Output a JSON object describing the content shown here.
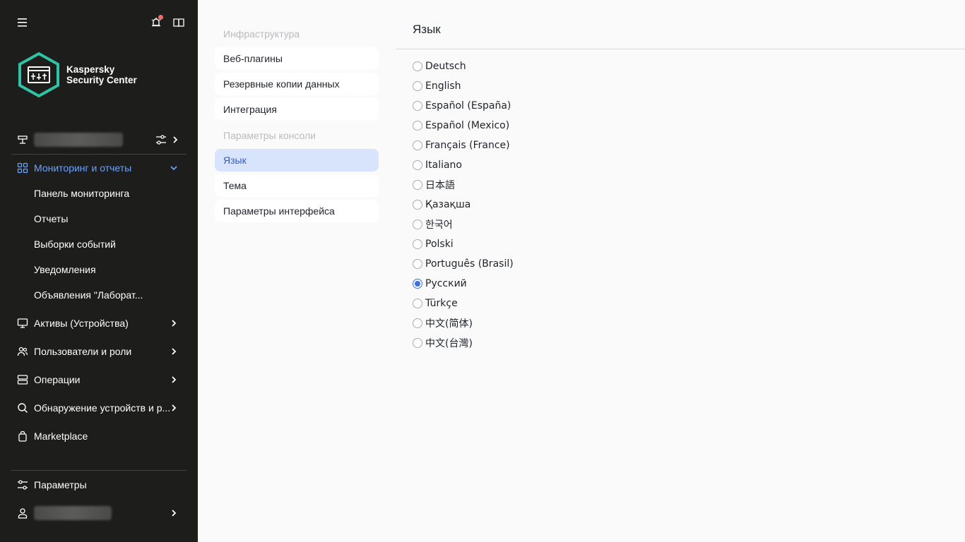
{
  "app": {
    "brand_line1": "Kaspersky",
    "brand_line2": "Security Center"
  },
  "colors": {
    "sidebar_bg": "#1d1d1b",
    "accent": "#3d6fe0",
    "active_nav": "#6aa2ff",
    "selected_menu_bg": "#d7e4fb",
    "notification_dot": "#f06b6b",
    "logo_teal": "#2ec4a6"
  },
  "sidebar": {
    "top_icons": [
      "hamburger-icon",
      "notifications-icon",
      "book-icon"
    ],
    "server_icon": "server-icon",
    "nav": [
      {
        "label": "Мониторинг и отчеты",
        "icon": "dashboard-icon",
        "active": true,
        "expanded": true,
        "children": [
          "Панель мониторинга",
          "Отчеты",
          "Выборки событий",
          "Уведомления",
          "Объявления \"Лаборат..."
        ]
      },
      {
        "label": "Активы (Устройства)",
        "icon": "monitor-icon"
      },
      {
        "label": "Пользователи и роли",
        "icon": "users-icon"
      },
      {
        "label": "Операции",
        "icon": "operations-icon"
      },
      {
        "label": "Обнаружение устройств и р...",
        "icon": "search-icon"
      },
      {
        "label": "Marketplace",
        "icon": "bag-icon"
      }
    ],
    "settings_label": "Параметры"
  },
  "menu": {
    "groups": [
      {
        "header": "Инфраструктура",
        "items": [
          "Веб-плагины",
          "Резервные копии данных",
          "Интеграция"
        ]
      },
      {
        "header": "Параметры консоли",
        "items": [
          "Язык",
          "Тема",
          "Параметры интерфейса"
        ]
      }
    ],
    "selected": "Язык"
  },
  "content": {
    "title": "Язык",
    "languages": [
      "Deutsch",
      "English",
      "Español (España)",
      "Español (Mexico)",
      "Français (France)",
      "Italiano",
      "日本語",
      "Қазақша",
      "한국어",
      "Polski",
      "Português (Brasil)",
      "Русский",
      "Türkçe",
      "中文(简体)",
      "中文(台灣)"
    ],
    "selected_language": "Русский"
  }
}
